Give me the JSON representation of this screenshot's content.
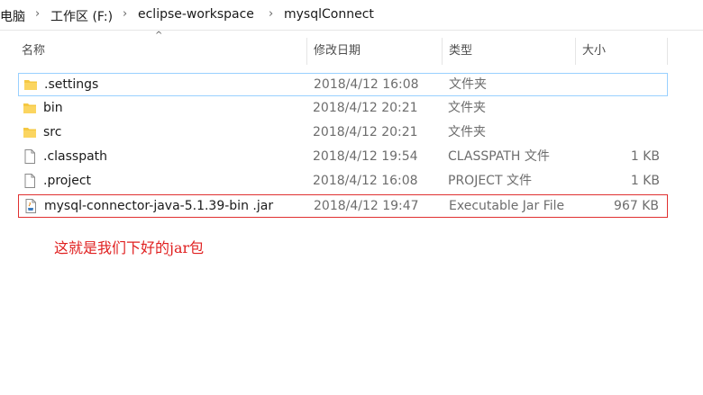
{
  "breadcrumb": {
    "items": [
      "电脑",
      "工作区 (F:)",
      "eclipse-workspace",
      "mysqlConnect"
    ],
    "separator": "›"
  },
  "columns": {
    "name": "名称",
    "date": "修改日期",
    "type": "类型",
    "size": "大小"
  },
  "files": [
    {
      "icon": "folder-icon",
      "name": ".settings",
      "date": "2018/4/12 16:08",
      "type": "文件夹",
      "size": ""
    },
    {
      "icon": "folder-icon",
      "name": "bin",
      "date": "2018/4/12 20:21",
      "type": "文件夹",
      "size": ""
    },
    {
      "icon": "folder-icon",
      "name": "src",
      "date": "2018/4/12 20:21",
      "type": "文件夹",
      "size": ""
    },
    {
      "icon": "file-icon",
      "name": ".classpath",
      "date": "2018/4/12 19:54",
      "type": "CLASSPATH 文件",
      "size": "1 KB"
    },
    {
      "icon": "file-icon",
      "name": ".project",
      "date": "2018/4/12 16:08",
      "type": "PROJECT 文件",
      "size": "1 KB"
    },
    {
      "icon": "jar-file-icon",
      "name": "mysql-connector-java-5.1.39-bin .jar",
      "date": "2018/4/12 19:47",
      "type": "Executable Jar File",
      "size": "967 KB"
    }
  ],
  "annotation": "这就是我们下好的jar包",
  "colors": {
    "folder": "#f5c842",
    "highlight_border": "#e03030",
    "focus_border": "#99d1ff",
    "annotation": "#e02020"
  }
}
